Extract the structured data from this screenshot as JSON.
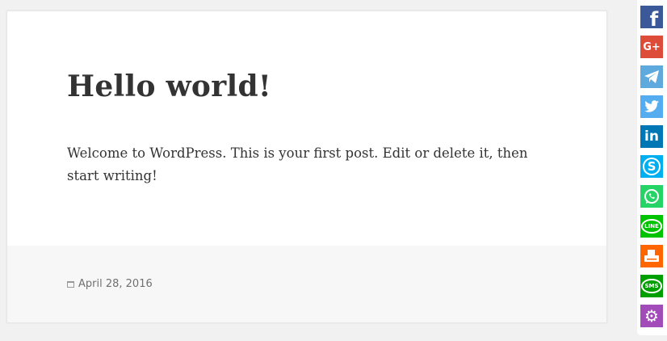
{
  "post": {
    "title": "Hello world!",
    "content": "Welcome to WordPress. This is your first post. Edit or delete it, then start writing!",
    "date": "April 28, 2016"
  },
  "share_buttons": [
    {
      "name": "facebook",
      "icon": "facebook-icon",
      "color": "#3b5998",
      "glyph": "f"
    },
    {
      "name": "google-plus",
      "icon": "google-plus-icon",
      "color": "#dd4b39",
      "glyph": "G+"
    },
    {
      "name": "telegram",
      "icon": "telegram-icon",
      "color": "#5ea9dd",
      "glyph": ""
    },
    {
      "name": "twitter",
      "icon": "twitter-icon",
      "color": "#55acee",
      "glyph": ""
    },
    {
      "name": "linkedin",
      "icon": "linkedin-icon",
      "color": "#0077b5",
      "glyph": "in"
    },
    {
      "name": "skype",
      "icon": "skype-icon",
      "color": "#00aff0",
      "glyph": "S"
    },
    {
      "name": "whatsapp",
      "icon": "whatsapp-icon",
      "color": "#25d366",
      "glyph": ""
    },
    {
      "name": "line",
      "icon": "line-icon",
      "color": "#00c300",
      "glyph": "LINE"
    },
    {
      "name": "print",
      "icon": "print-icon",
      "color": "#ff6600",
      "glyph": ""
    },
    {
      "name": "sms",
      "icon": "sms-icon",
      "color": "#009f00",
      "glyph": "SMS"
    },
    {
      "name": "more",
      "icon": "gear-icon",
      "color": "#a24cba",
      "glyph": "⚙"
    }
  ]
}
